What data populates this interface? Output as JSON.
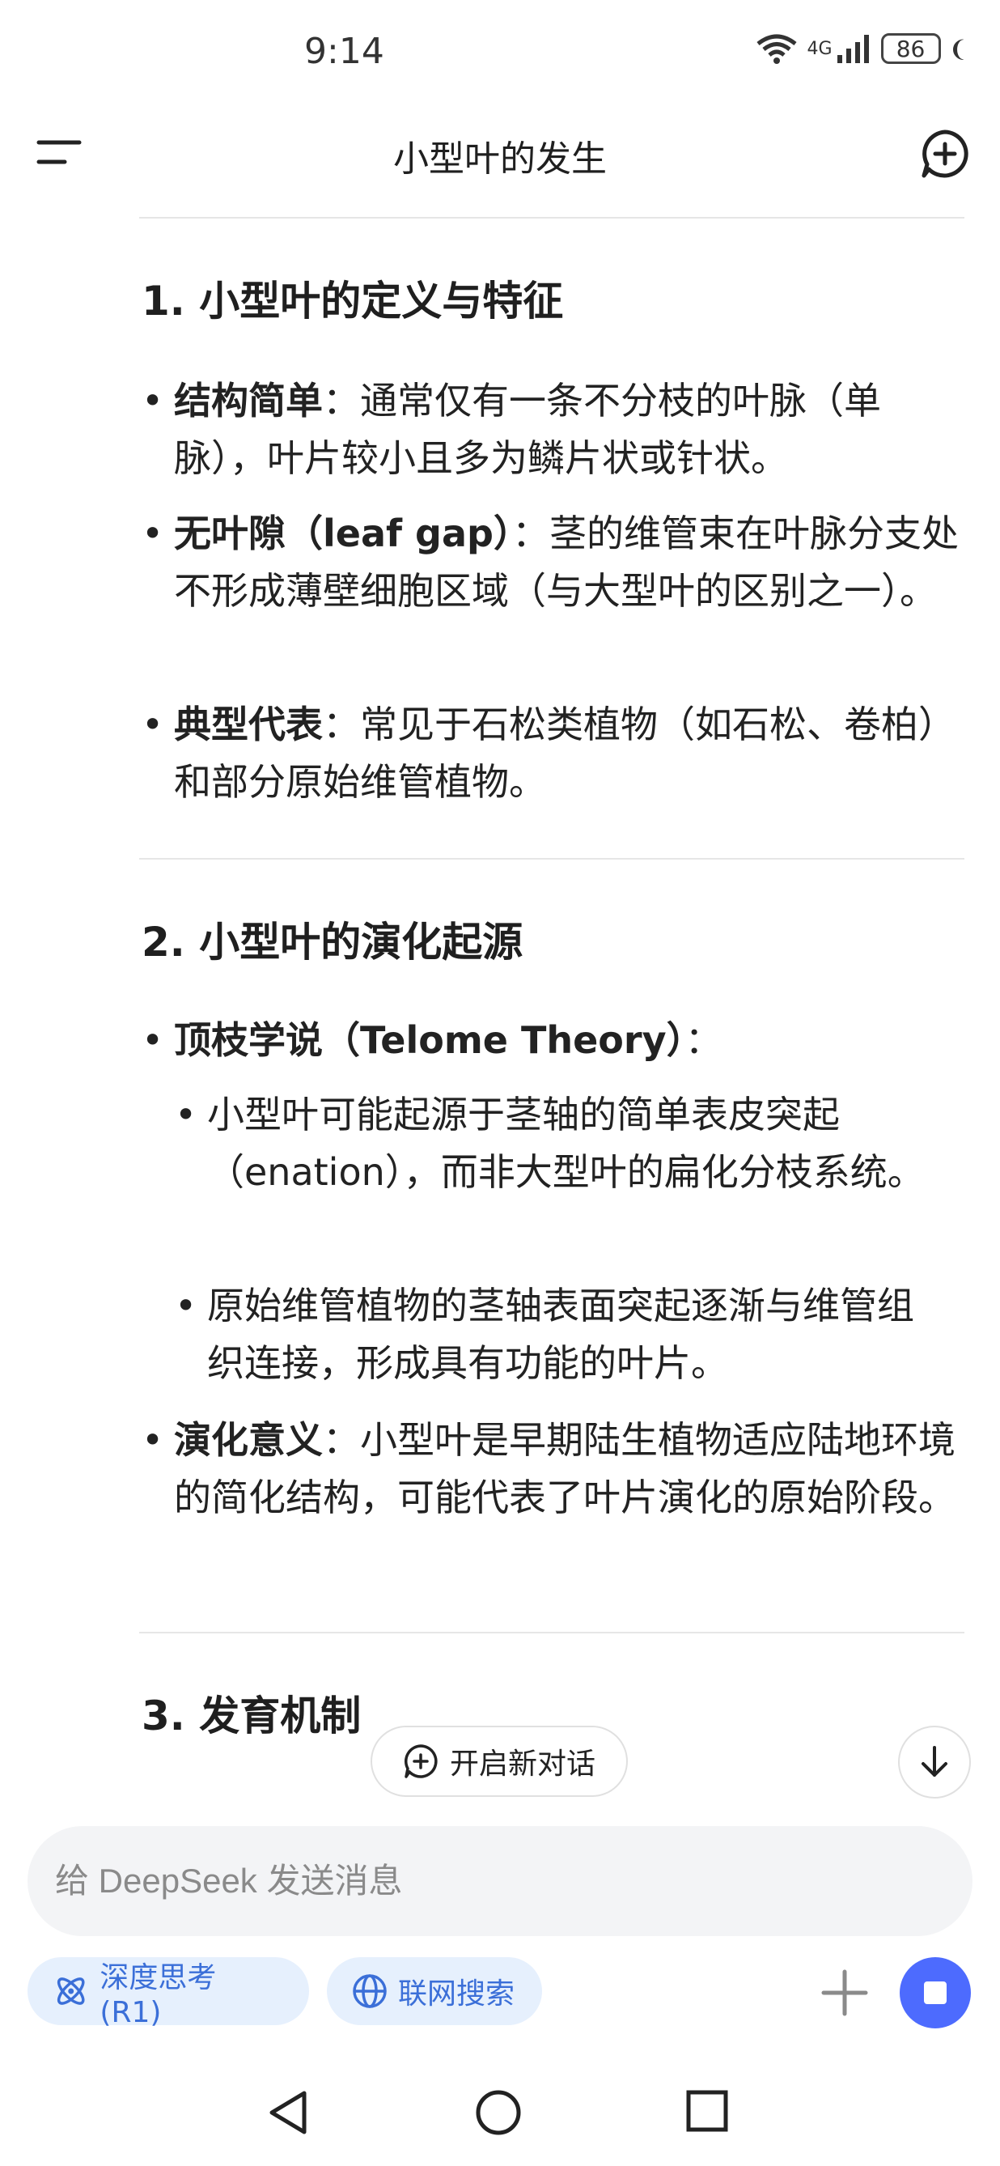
{
  "status_bar": {
    "time": "9:14",
    "network": "4G",
    "battery": "86"
  },
  "header": {
    "title": "小型叶的发生"
  },
  "sections": [
    {
      "heading": "1. 小型叶的定义与特征",
      "items": [
        {
          "bold": "结构简单",
          "text": "：通常仅有一条不分枝的叶脉（单脉），叶片较小且多为鳞片状或针状。"
        },
        {
          "bold": "无叶隙（leaf gap）",
          "text": "：茎的维管束在叶脉分支处不形成薄壁细胞区域（与大型叶的区别之一）。"
        },
        {
          "bold": "典型代表",
          "text": "：常见于石松类植物（如石松、卷柏）和部分原始维管植物。"
        }
      ]
    },
    {
      "heading": "2. 小型叶的演化起源",
      "items": [
        {
          "bold": "顶枝学说（Telome Theory）",
          "text": "：",
          "subitems": [
            "小型叶可能起源于茎轴的简单表皮突起（enation），而非大型叶的扁化分枝系统。",
            "原始维管植物的茎轴表面突起逐渐与维管组织连接，形成具有功能的叶片。"
          ]
        },
        {
          "bold": "演化意义",
          "text": "：小型叶是早期陆生植物适应陆地环境的简化结构，可能代表了叶片演化的原始阶段。"
        }
      ]
    },
    {
      "heading": "3. 发育机制"
    }
  ],
  "floating": {
    "new_chat_label": "开启新对话"
  },
  "input": {
    "placeholder": "给 DeepSeek 发送消息"
  },
  "chips": {
    "deepthink": "深度思考 (R1)",
    "search": "联网搜索"
  },
  "colors": {
    "accent": "#4d6bfe",
    "chip_bg": "#e6f0fd",
    "chip_text": "#3b6fd8"
  },
  "icons": [
    "menu-icon",
    "new-chat-icon",
    "chat-plus-icon",
    "arrow-down-icon",
    "atom-icon",
    "globe-icon",
    "plus-icon",
    "stop-icon",
    "back-icon",
    "home-icon",
    "recents-icon",
    "wifi-icon",
    "signal-icon"
  ]
}
